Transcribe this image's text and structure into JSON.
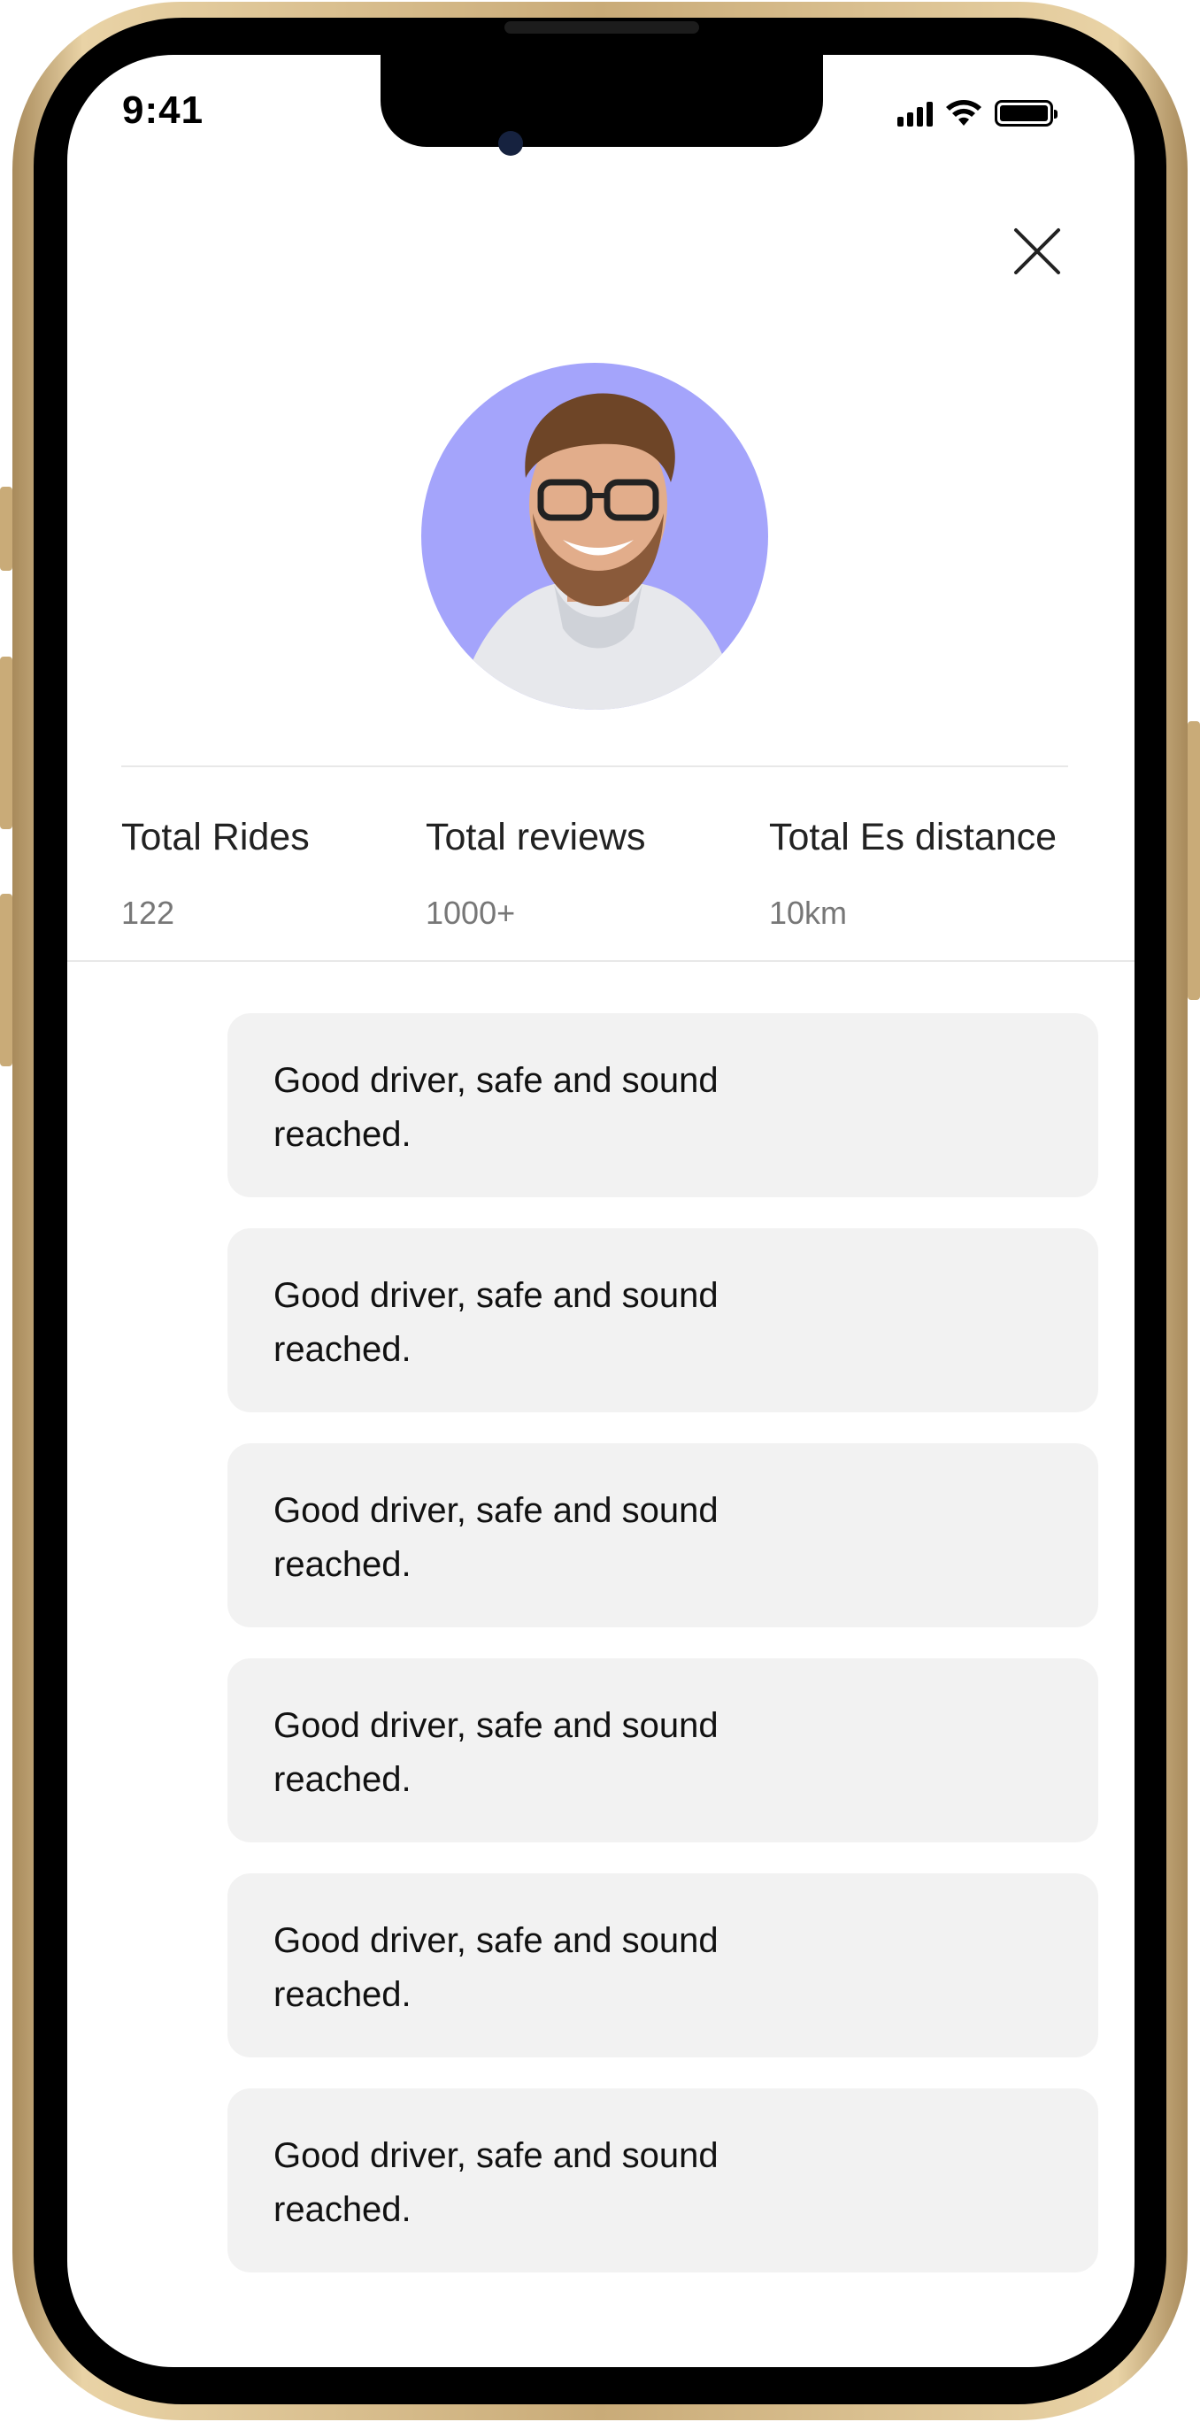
{
  "status_bar": {
    "time": "9:41"
  },
  "profile": {
    "avatar_alt": "Driver profile photo"
  },
  "stats": [
    {
      "label": "Total Rides",
      "value": "122"
    },
    {
      "label": "Total reviews",
      "value": "1000+"
    },
    {
      "label": "Total Es distance",
      "value": "10km"
    }
  ],
  "reviews": [
    {
      "text": "Good driver, safe and sound reached."
    },
    {
      "text": "Good driver, safe and sound reached."
    },
    {
      "text": "Good driver, safe and sound reached."
    },
    {
      "text": "Good driver, safe and sound reached."
    },
    {
      "text": "Good driver, safe and sound reached."
    },
    {
      "text": "Good driver, safe and sound reached."
    }
  ],
  "colors": {
    "avatar_bg": "#a4a4fb",
    "card_bg": "#f2f2f2",
    "frame_gold": "#c9ab78"
  },
  "icons": {
    "close": "close-icon",
    "signal": "signal-icon",
    "wifi": "wifi-icon",
    "battery": "battery-icon"
  }
}
